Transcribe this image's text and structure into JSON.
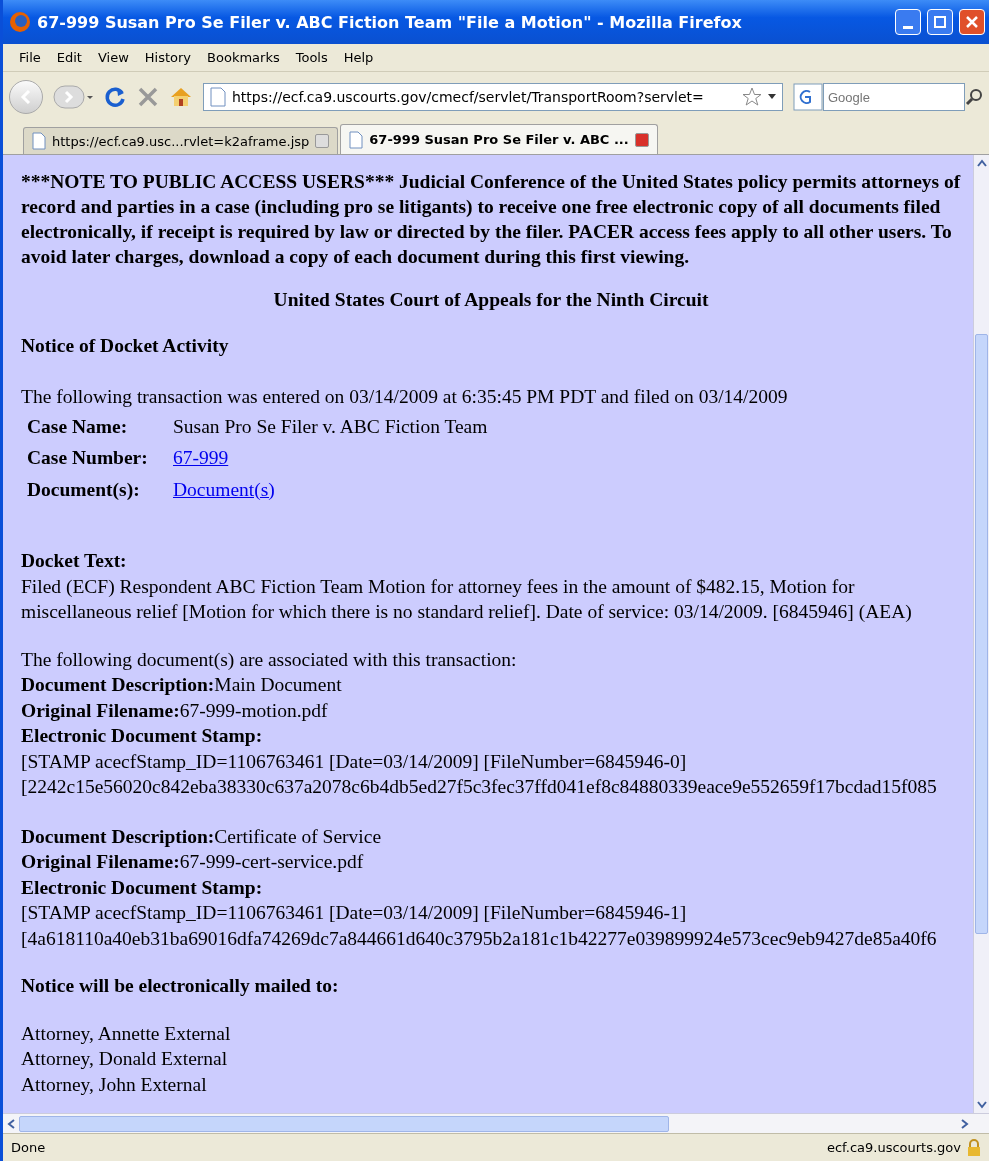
{
  "window": {
    "title": "67-999 Susan Pro Se Filer v. ABC Fiction Team \"File a Motion\" - Mozilla Firefox"
  },
  "menu": [
    "File",
    "Edit",
    "View",
    "History",
    "Bookmarks",
    "Tools",
    "Help"
  ],
  "toolbar": {
    "url": "https://ecf.ca9.uscourts.gov/cmecf/servlet/TransportRoom?servlet=",
    "search_placeholder": "Google"
  },
  "tabs": [
    {
      "label": "https://ecf.ca9.usc...rvlet=k2aframe.jsp",
      "selected": false
    },
    {
      "label": "67-999 Susan Pro Se Filer v. ABC ...",
      "selected": true
    }
  ],
  "page": {
    "notice": "***NOTE TO PUBLIC ACCESS USERS*** Judicial Conference of the United States policy permits attorneys of record and parties in a case (including pro se litigants) to receive one free electronic copy of all documents filed electronically, if receipt is required by law or directed by the filer. PACER access fees apply to all other users. To avoid later charges, download a copy of each document during this first viewing.",
    "court": "United States Court of Appeals for the Ninth Circuit",
    "heading": "Notice of Docket Activity",
    "transaction": "The following transaction was entered on 03/14/2009 at 6:35:45 PM PDT and filed on 03/14/2009",
    "fields": [
      {
        "label": "Case Name:",
        "value": "Susan Pro Se Filer v. ABC Fiction Team",
        "kind": "text"
      },
      {
        "label": "Case Number:",
        "value": "67-999",
        "kind": "link"
      },
      {
        "label": "Document(s):",
        "value": "Document(s)",
        "kind": "link"
      }
    ],
    "docket_label": "Docket Text:",
    "docket_text": "Filed (ECF) Respondent ABC Fiction Team Motion for attorney fees in the amount of $482.15, Motion for miscellaneous relief [Motion for which there is no standard relief]. Date of service: 03/14/2009. [6845946] (AEA)",
    "associated": "The following document(s) are associated with this transaction:",
    "documents": [
      {
        "description_label": "Document Description:",
        "description": "Main Document",
        "filename_label": "Original Filename:",
        "filename": "67-999-motion.pdf",
        "stamp_label": "Electronic Document Stamp:",
        "stamp": "[STAMP acecfStamp_ID=1106763461 [Date=03/14/2009] [FileNumber=6845946-0]",
        "hash": "[2242c15e56020c842eba38330c637a2078c6b4db5ed27f5c3fec37ffd041ef8c84880339eace9e552659f17bcdad15f085"
      },
      {
        "description_label": "Document Description:",
        "description": "Certificate of Service",
        "filename_label": "Original Filename:",
        "filename": "67-999-cert-service.pdf",
        "stamp_label": "Electronic Document Stamp:",
        "stamp": "[STAMP acecfStamp_ID=1106763461 [Date=03/14/2009] [FileNumber=6845946-1]",
        "hash": "[4a618110a40eb31ba69016dfa74269dc7a844661d640c3795b2a181c1b42277e039899924e573cec9eb9427de85a40f6"
      }
    ],
    "mailed_heading": "Notice will be electronically mailed to:",
    "recipients": [
      "Attorney, Annette External",
      "Attorney, Donald External",
      "Attorney, John External"
    ]
  },
  "status_bar": {
    "text": "Done",
    "host": "ecf.ca9.uscourts.gov"
  }
}
